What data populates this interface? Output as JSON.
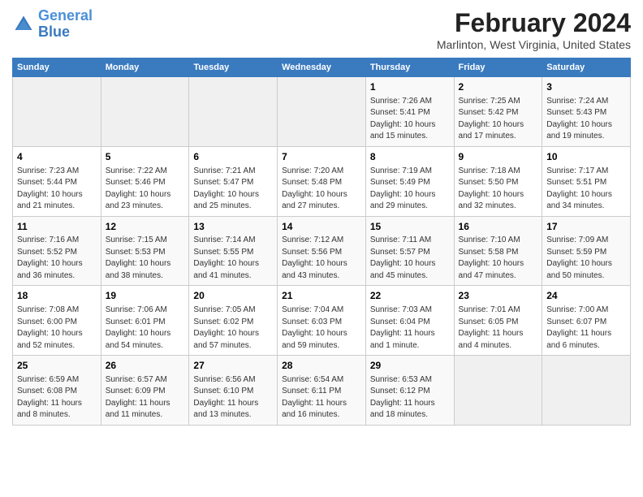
{
  "header": {
    "logo_line1": "General",
    "logo_line2": "Blue",
    "title": "February 2024",
    "subtitle": "Marlinton, West Virginia, United States"
  },
  "calendar": {
    "days_of_week": [
      "Sunday",
      "Monday",
      "Tuesday",
      "Wednesday",
      "Thursday",
      "Friday",
      "Saturday"
    ],
    "weeks": [
      [
        {
          "num": "",
          "empty": true
        },
        {
          "num": "",
          "empty": true
        },
        {
          "num": "",
          "empty": true
        },
        {
          "num": "",
          "empty": true
        },
        {
          "num": "1",
          "info": "Sunrise: 7:26 AM\nSunset: 5:41 PM\nDaylight: 10 hours\nand 15 minutes."
        },
        {
          "num": "2",
          "info": "Sunrise: 7:25 AM\nSunset: 5:42 PM\nDaylight: 10 hours\nand 17 minutes."
        },
        {
          "num": "3",
          "info": "Sunrise: 7:24 AM\nSunset: 5:43 PM\nDaylight: 10 hours\nand 19 minutes."
        }
      ],
      [
        {
          "num": "4",
          "info": "Sunrise: 7:23 AM\nSunset: 5:44 PM\nDaylight: 10 hours\nand 21 minutes."
        },
        {
          "num": "5",
          "info": "Sunrise: 7:22 AM\nSunset: 5:46 PM\nDaylight: 10 hours\nand 23 minutes."
        },
        {
          "num": "6",
          "info": "Sunrise: 7:21 AM\nSunset: 5:47 PM\nDaylight: 10 hours\nand 25 minutes."
        },
        {
          "num": "7",
          "info": "Sunrise: 7:20 AM\nSunset: 5:48 PM\nDaylight: 10 hours\nand 27 minutes."
        },
        {
          "num": "8",
          "info": "Sunrise: 7:19 AM\nSunset: 5:49 PM\nDaylight: 10 hours\nand 29 minutes."
        },
        {
          "num": "9",
          "info": "Sunrise: 7:18 AM\nSunset: 5:50 PM\nDaylight: 10 hours\nand 32 minutes."
        },
        {
          "num": "10",
          "info": "Sunrise: 7:17 AM\nSunset: 5:51 PM\nDaylight: 10 hours\nand 34 minutes."
        }
      ],
      [
        {
          "num": "11",
          "info": "Sunrise: 7:16 AM\nSunset: 5:52 PM\nDaylight: 10 hours\nand 36 minutes."
        },
        {
          "num": "12",
          "info": "Sunrise: 7:15 AM\nSunset: 5:53 PM\nDaylight: 10 hours\nand 38 minutes."
        },
        {
          "num": "13",
          "info": "Sunrise: 7:14 AM\nSunset: 5:55 PM\nDaylight: 10 hours\nand 41 minutes."
        },
        {
          "num": "14",
          "info": "Sunrise: 7:12 AM\nSunset: 5:56 PM\nDaylight: 10 hours\nand 43 minutes."
        },
        {
          "num": "15",
          "info": "Sunrise: 7:11 AM\nSunset: 5:57 PM\nDaylight: 10 hours\nand 45 minutes."
        },
        {
          "num": "16",
          "info": "Sunrise: 7:10 AM\nSunset: 5:58 PM\nDaylight: 10 hours\nand 47 minutes."
        },
        {
          "num": "17",
          "info": "Sunrise: 7:09 AM\nSunset: 5:59 PM\nDaylight: 10 hours\nand 50 minutes."
        }
      ],
      [
        {
          "num": "18",
          "info": "Sunrise: 7:08 AM\nSunset: 6:00 PM\nDaylight: 10 hours\nand 52 minutes."
        },
        {
          "num": "19",
          "info": "Sunrise: 7:06 AM\nSunset: 6:01 PM\nDaylight: 10 hours\nand 54 minutes."
        },
        {
          "num": "20",
          "info": "Sunrise: 7:05 AM\nSunset: 6:02 PM\nDaylight: 10 hours\nand 57 minutes."
        },
        {
          "num": "21",
          "info": "Sunrise: 7:04 AM\nSunset: 6:03 PM\nDaylight: 10 hours\nand 59 minutes."
        },
        {
          "num": "22",
          "info": "Sunrise: 7:03 AM\nSunset: 6:04 PM\nDaylight: 11 hours\nand 1 minute."
        },
        {
          "num": "23",
          "info": "Sunrise: 7:01 AM\nSunset: 6:05 PM\nDaylight: 11 hours\nand 4 minutes."
        },
        {
          "num": "24",
          "info": "Sunrise: 7:00 AM\nSunset: 6:07 PM\nDaylight: 11 hours\nand 6 minutes."
        }
      ],
      [
        {
          "num": "25",
          "info": "Sunrise: 6:59 AM\nSunset: 6:08 PM\nDaylight: 11 hours\nand 8 minutes."
        },
        {
          "num": "26",
          "info": "Sunrise: 6:57 AM\nSunset: 6:09 PM\nDaylight: 11 hours\nand 11 minutes."
        },
        {
          "num": "27",
          "info": "Sunrise: 6:56 AM\nSunset: 6:10 PM\nDaylight: 11 hours\nand 13 minutes."
        },
        {
          "num": "28",
          "info": "Sunrise: 6:54 AM\nSunset: 6:11 PM\nDaylight: 11 hours\nand 16 minutes."
        },
        {
          "num": "29",
          "info": "Sunrise: 6:53 AM\nSunset: 6:12 PM\nDaylight: 11 hours\nand 18 minutes."
        },
        {
          "num": "",
          "empty": true
        },
        {
          "num": "",
          "empty": true
        }
      ]
    ]
  }
}
